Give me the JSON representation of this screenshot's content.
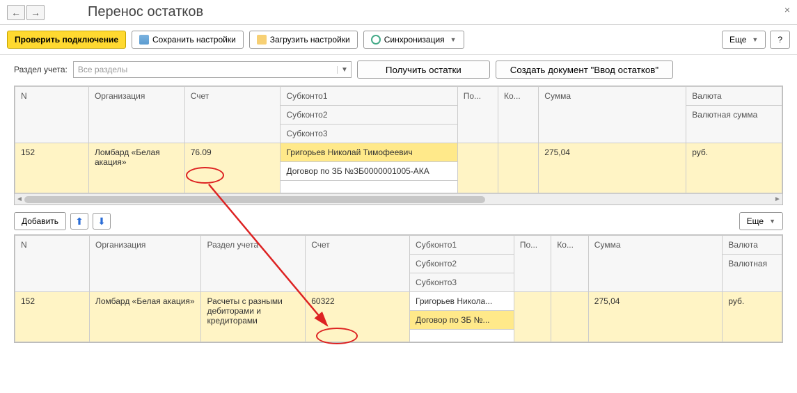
{
  "header": {
    "title": "Перенос остатков"
  },
  "toolbar": {
    "check_connection": "Проверить подключение",
    "save_settings": "Сохранить настройки",
    "load_settings": "Загрузить настройки",
    "sync": "Синхронизация",
    "more": "Еще",
    "help": "?"
  },
  "filter": {
    "label": "Раздел учета:",
    "placeholder": "Все разделы",
    "get_balances": "Получить остатки",
    "create_doc": "Создать документ \"Ввод остатков\""
  },
  "table1": {
    "headers": {
      "n": "N",
      "org": "Организация",
      "account": "Счет",
      "sub1": "Субконто1",
      "sub2": "Субконто2",
      "sub3": "Субконто3",
      "po": "По...",
      "ko": "Ко...",
      "sum": "Сумма",
      "currency": "Валюта",
      "currency_sum": "Валютная сумма"
    },
    "rows": [
      {
        "n": "152",
        "org": "Ломбард «Белая акация»",
        "account": "76.09",
        "sub1": "Григорьев Николай Тимофеевич",
        "sub2": "Договор по ЗБ №ЗБ0000001005-АКА",
        "sub3": "",
        "po": "",
        "ko": "",
        "sum": "275,04",
        "currency": "руб."
      }
    ]
  },
  "midbar": {
    "add": "Добавить",
    "more": "Еще"
  },
  "table2": {
    "headers": {
      "n": "N",
      "org": "Организация",
      "section": "Раздел учета",
      "account": "Счет",
      "sub1": "Субконто1",
      "sub2": "Субконто2",
      "sub3": "Субконто3",
      "po": "По...",
      "ko": "Ко...",
      "sum": "Сумма",
      "currency": "Валюта",
      "currency_sum": "Валютная"
    },
    "rows": [
      {
        "n": "152",
        "org": "Ломбард «Белая акация»",
        "section": "Расчеты с разными дебиторами и кредиторами",
        "account": "60322",
        "sub1": "Григорьев Никола...",
        "sub2": "Договор по ЗБ №...",
        "sub3": "",
        "po": "",
        "ko": "",
        "sum": "275,04",
        "currency": "руб."
      }
    ]
  }
}
